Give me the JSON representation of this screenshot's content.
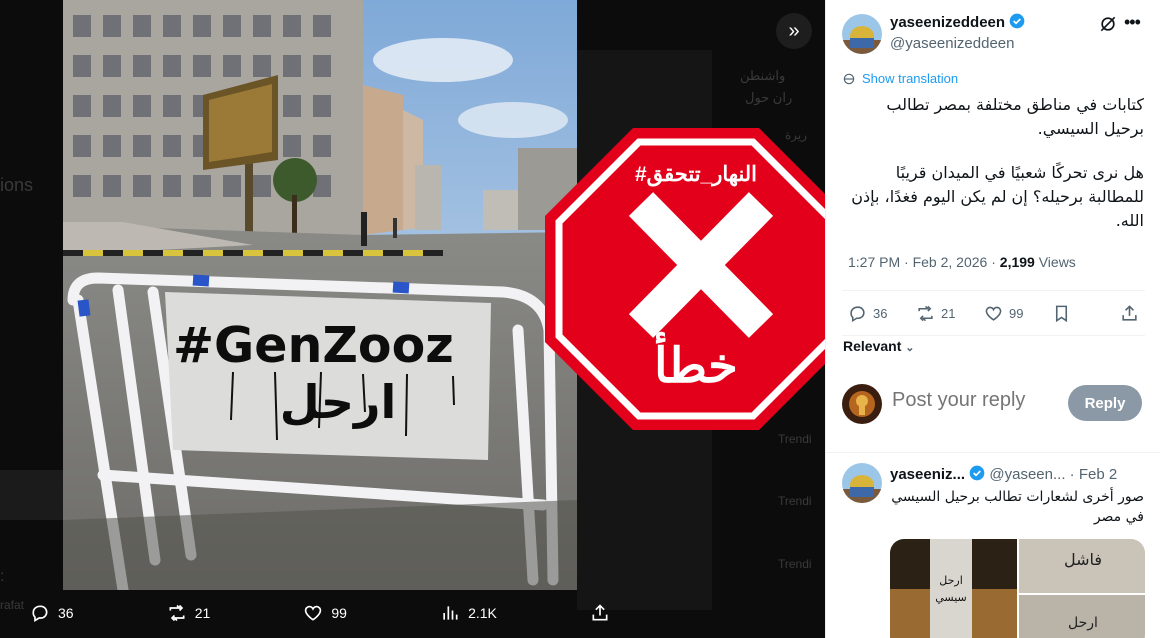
{
  "viewer": {
    "ghost_text": [
      "ions",
      "واشنطن",
      "ران حول",
      "ريرة",
      "Trendi",
      "Trendi",
      "Trendi",
      "rafat",
      ":"
    ],
    "photo": {
      "graffiti_tag": "#GenZooz",
      "graffiti_word": "ارحل"
    },
    "stamp": {
      "hashtag": "#النهار_تتحقق",
      "verdict": "خطأ",
      "color": "#e2001a"
    },
    "bottom_bar": {
      "replies": "36",
      "reposts": "21",
      "likes": "99",
      "views": "2.1K"
    }
  },
  "post": {
    "author": {
      "name": "yaseenizeddeen",
      "handle": "@yaseenizeddeen"
    },
    "show_translation": "Show translation",
    "text": [
      "كتابات في مناطق مختلفة بمصر تطالب برحيل السيسي.",
      "هل نرى تحركًا شعبيًا في الميدان قريبًا للمطالبة برحيله؟ إن لم يكن اليوم فغدًا، بإذن الله."
    ],
    "time": "1:27 PM",
    "date": "Feb 2, 2026",
    "views_count": "2,199",
    "views_label": "Views",
    "replies": "36",
    "reposts": "21",
    "likes": "99",
    "relevant_label": "Relevant"
  },
  "compose": {
    "placeholder": "Post your reply",
    "reply_button": "Reply"
  },
  "reply": {
    "name": "yaseeniz...",
    "handle": "@yaseen...",
    "date": "Feb 2",
    "text": "صور أخرى لشعارات تطالب برحيل السيسي في مصر",
    "media_text": [
      "ارحل",
      "سيسي",
      "ارحل",
      "فاشل"
    ]
  },
  "colors": {
    "accent": "#1d9bf0",
    "verified": "#1d9bf0",
    "stamp_red": "#e2001a"
  }
}
